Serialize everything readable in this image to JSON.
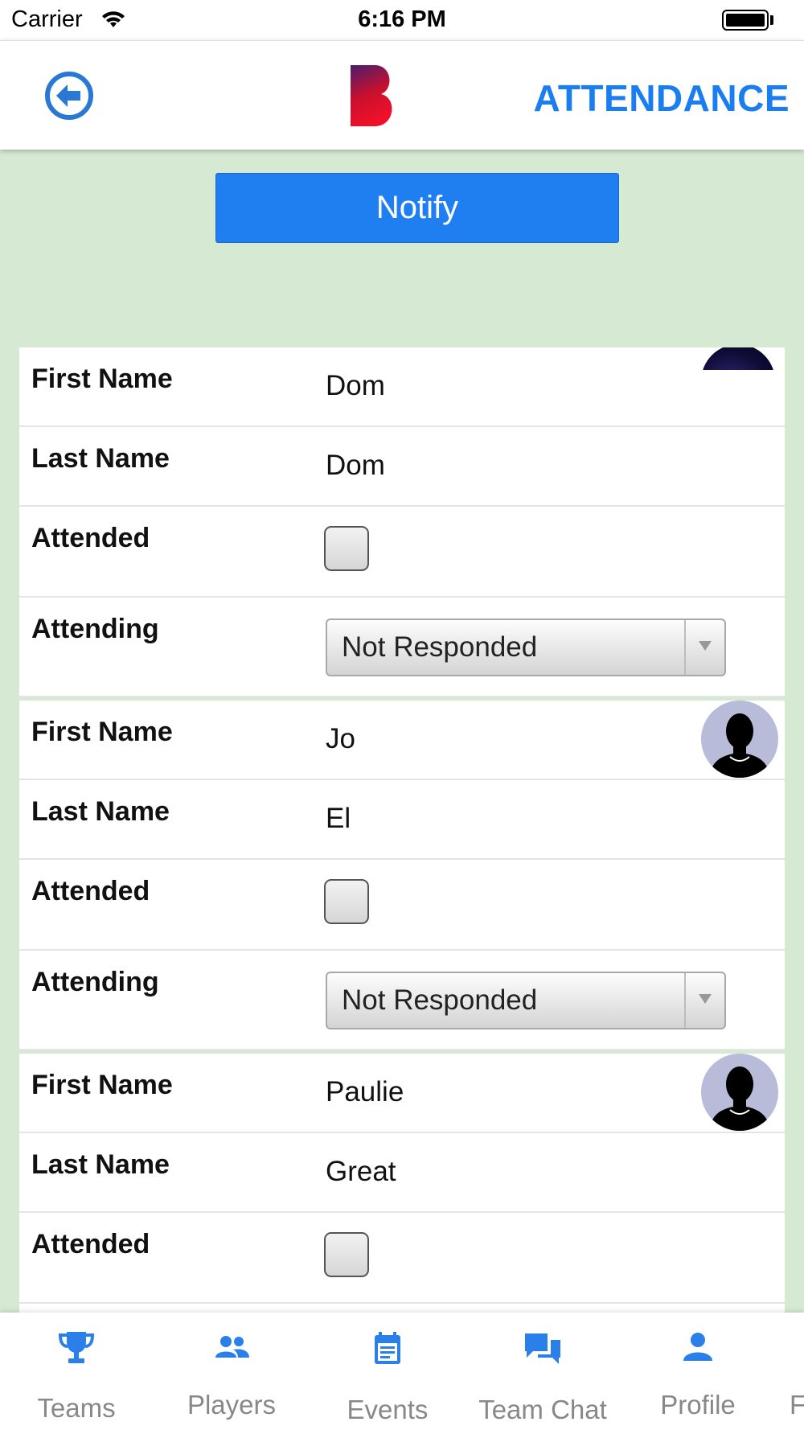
{
  "status_bar": {
    "carrier": "Carrier",
    "time": "6:16 PM"
  },
  "header": {
    "title": "ATTENDANCE",
    "back_icon": "arrow-left-circle-icon",
    "logo": "B"
  },
  "actions": {
    "notify_label": "Notify"
  },
  "colors": {
    "accent": "#1a7ef0",
    "background": "#d6ead3",
    "logo_top": "#4a1e6e",
    "logo_bottom": "#e0102a"
  },
  "field_labels": {
    "first_name": "First Name",
    "last_name": "Last Name",
    "attended": "Attended",
    "attending": "Attending"
  },
  "players": [
    {
      "first_name": "Dom",
      "last_name": "Dom",
      "attended": false,
      "attending": "Not Responded",
      "avatar": "photo"
    },
    {
      "first_name": "Jo",
      "last_name": "El",
      "attended": false,
      "attending": "Not Responded",
      "avatar": "silhouette"
    },
    {
      "first_name": "Paulie",
      "last_name": "Great",
      "attended": false,
      "attending": "",
      "avatar": "silhouette"
    }
  ],
  "tabs": [
    {
      "label": "Teams",
      "icon": "trophy-icon"
    },
    {
      "label": "Players",
      "icon": "people-icon"
    },
    {
      "label": "Events",
      "icon": "calendar-icon"
    },
    {
      "label": "Team Chat",
      "icon": "chat-icon"
    },
    {
      "label": "Profile",
      "icon": "person-icon"
    },
    {
      "label": "F",
      "icon": ""
    }
  ]
}
